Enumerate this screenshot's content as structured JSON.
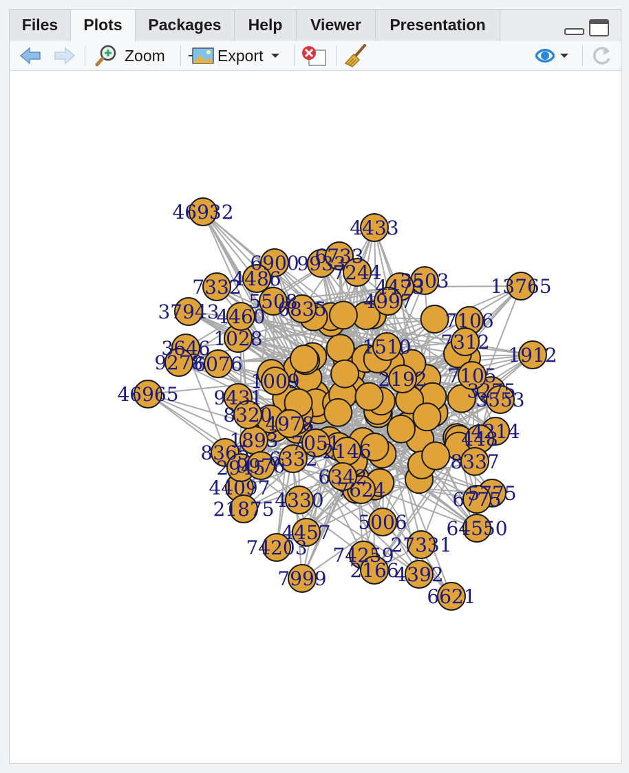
{
  "tabs": [
    {
      "label": "Files",
      "active": false
    },
    {
      "label": "Plots",
      "active": true
    },
    {
      "label": "Packages",
      "active": false
    },
    {
      "label": "Help",
      "active": false
    },
    {
      "label": "Viewer",
      "active": false
    },
    {
      "label": "Presentation",
      "active": false
    }
  ],
  "toolbar": {
    "zoom_label": "Zoom",
    "export_label": "Export"
  },
  "colors": {
    "node_fill": "#e0a33a",
    "node_stroke": "#1a1a1a",
    "edge": "#aaaaaa",
    "label": "#1a1a80"
  },
  "icons": [
    "back-arrow-icon",
    "forward-arrow-icon",
    "zoom-icon",
    "export-icon",
    "remove-plot-icon",
    "broom-icon",
    "publish-icon",
    "refresh-icon",
    "minimize-icon",
    "maximize-icon"
  ],
  "graph": {
    "labels": [
      "46932",
      "4433",
      "13765",
      "1912",
      "46965",
      "6621",
      "7999",
      "44097",
      "37943",
      "21875",
      "74203",
      "64550",
      "8365",
      "6900",
      "7332",
      "3646",
      "4486",
      "3503",
      "9278",
      "9431",
      "1893",
      "4457",
      "74259",
      "2166",
      "4392",
      "27331",
      "8320",
      "1009",
      "7106",
      "3275",
      "3553",
      "4214",
      "448",
      "5775",
      "4330",
      "2945",
      "9976",
      "6775",
      "8337",
      "6332",
      "1028",
      "7312",
      "2146",
      "5508",
      "4460",
      "6076",
      "4473",
      "6835",
      "4997",
      "9933",
      "6733",
      "7244",
      "1510",
      "7105",
      "4978",
      "7051",
      "7624",
      "5006",
      "2192",
      "6342"
    ]
  }
}
